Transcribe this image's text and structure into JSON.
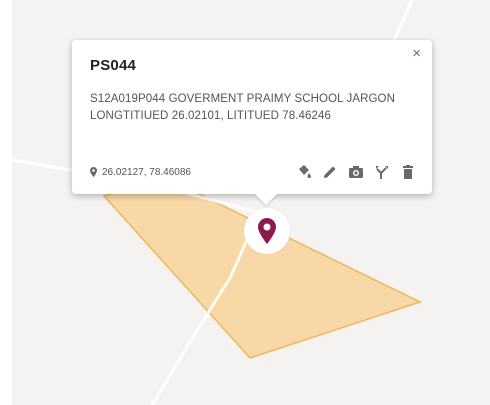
{
  "popup": {
    "title": "PS044",
    "close_label": "×",
    "description": "S12A019P044 GOVERMENT PRAIMY SCHOOL JARGON LONGTITIUED 26.02101, LITITUED 78.46246",
    "coordinates": "26.02127, 78.46086",
    "tools": [
      "paint-bucket-icon",
      "pencil-icon",
      "camera-icon",
      "fork-icon",
      "trash-icon"
    ]
  },
  "colors": {
    "polygon_fill": "#f7d8a6",
    "polygon_stroke": "#f0b757",
    "marker": "#8b1a4f",
    "map_background": "#f4f3f2",
    "road": "#ffffff",
    "icon": "#6a6a6a"
  },
  "icons": {
    "coord_pin": "map-pin-icon",
    "marker": "location-marker-icon"
  }
}
